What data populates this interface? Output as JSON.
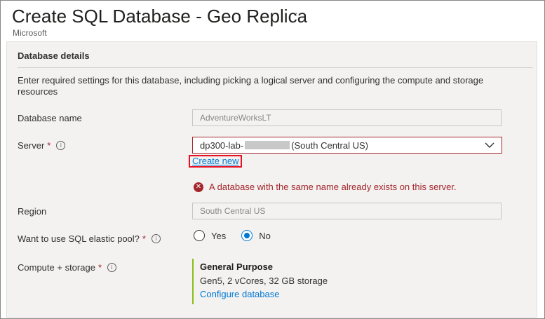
{
  "header": {
    "title": "Create SQL Database - Geo Replica",
    "more_label": "···",
    "publisher": "Microsoft"
  },
  "section": {
    "title": "Database details",
    "description": "Enter required settings for this database, including picking a logical server and configuring the compute and storage resources"
  },
  "fields": {
    "database_name": {
      "label": "Database name",
      "value": "AdventureWorksLT"
    },
    "server": {
      "label": "Server",
      "required_mark": "*",
      "value_prefix": "dp300-lab-",
      "value_suffix": "(South Central US)",
      "create_new": "Create new",
      "error": "A database with the same name already exists on this server."
    },
    "region": {
      "label": "Region",
      "value": "South Central US"
    },
    "elastic_pool": {
      "label": "Want to use SQL elastic pool?",
      "required_mark": "*",
      "options": [
        "Yes",
        "No"
      ],
      "selected": "No"
    },
    "compute": {
      "label": "Compute + storage",
      "required_mark": "*",
      "tier": "General Purpose",
      "spec": "Gen5, 2 vCores, 32 GB storage",
      "configure": "Configure database"
    }
  },
  "colors": {
    "error": "#a4262c",
    "link": "#0078d4",
    "highlight": "#e81123",
    "compute_bar": "#8cbd18"
  },
  "icons": [
    "more-icon",
    "info-icon",
    "chevron-down-icon",
    "error-icon"
  ]
}
